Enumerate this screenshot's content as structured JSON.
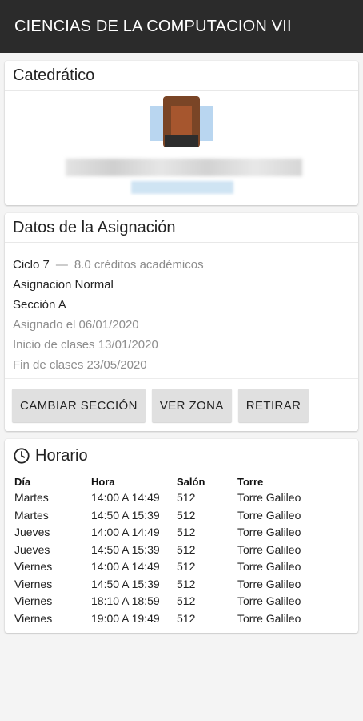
{
  "app": {
    "title": "CIENCIAS DE LA COMPUTACION VII"
  },
  "catedratico": {
    "title": "Catedrático"
  },
  "asignacion": {
    "title": "Datos de la Asignación",
    "ciclo": "Ciclo 7",
    "separator": "—",
    "creditos": "8.0 créditos académicos",
    "tipo": "Asignacion Normal",
    "seccion": "Sección A",
    "asignado": "Asignado el 06/01/2020",
    "inicio": "Inicio de clases 13/01/2020",
    "fin": "Fin de clases 23/05/2020",
    "buttons": {
      "cambiar": "CAMBIAR SECCIÓN",
      "zona": "VER ZONA",
      "retirar": "RETIRAR"
    }
  },
  "horario": {
    "title": "Horario",
    "headers": {
      "dia": "Día",
      "hora": "Hora",
      "salon": "Salón",
      "torre": "Torre"
    },
    "rows": [
      {
        "dia": "Martes",
        "hora": "14:00 A 14:49",
        "salon": "512",
        "torre": "Torre Galileo"
      },
      {
        "dia": "Martes",
        "hora": "14:50 A 15:39",
        "salon": "512",
        "torre": "Torre Galileo"
      },
      {
        "dia": "Jueves",
        "hora": "14:00 A 14:49",
        "salon": "512",
        "torre": "Torre Galileo"
      },
      {
        "dia": "Jueves",
        "hora": "14:50 A 15:39",
        "salon": "512",
        "torre": "Torre Galileo"
      },
      {
        "dia": "Viernes",
        "hora": "14:00 A 14:49",
        "salon": "512",
        "torre": "Torre Galileo"
      },
      {
        "dia": "Viernes",
        "hora": "14:50 A 15:39",
        "salon": "512",
        "torre": "Torre Galileo"
      },
      {
        "dia": "Viernes",
        "hora": "18:10 A 18:59",
        "salon": "512",
        "torre": "Torre Galileo"
      },
      {
        "dia": "Viernes",
        "hora": "19:00 A 19:49",
        "salon": "512",
        "torre": "Torre Galileo"
      }
    ]
  },
  "colors": {
    "appbar": "#2b2b2b",
    "button": "#e0e0e0",
    "muted_text": "#8d8d8d"
  }
}
